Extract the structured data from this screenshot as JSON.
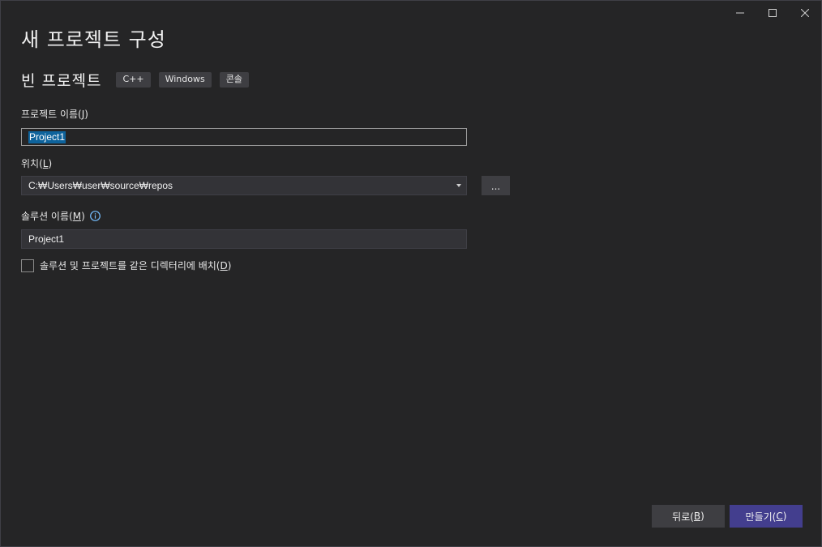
{
  "window": {
    "title": "새 프로젝트 구성"
  },
  "template": {
    "name": "빈 프로젝트",
    "tags": [
      "C++",
      "Windows",
      "콘솔"
    ]
  },
  "project_name": {
    "label": "프로젝트 이름(",
    "label_key": "J",
    "label_end": ")",
    "value": "Project1"
  },
  "location": {
    "label": "위치(",
    "label_key": "L",
    "label_end": ")",
    "value": "C:₩Users₩user₩source₩repos",
    "browse_label": "..."
  },
  "solution_name": {
    "label": "솔루션 이름(",
    "label_key": "M",
    "label_end": ")",
    "value": "Project1"
  },
  "same_directory": {
    "label": "솔루션 및 프로젝트를 같은 디렉터리에 배치(",
    "label_key": "D",
    "label_end": ")",
    "checked": false
  },
  "footer": {
    "back_label": "뒤로(",
    "back_key": "B",
    "back_end": ")",
    "create_label": "만들기(",
    "create_key": "C",
    "create_end": ")"
  },
  "colors": {
    "background": "#252526",
    "accent": "#433e8e",
    "selection": "#0e639c",
    "info": "#75beff"
  }
}
